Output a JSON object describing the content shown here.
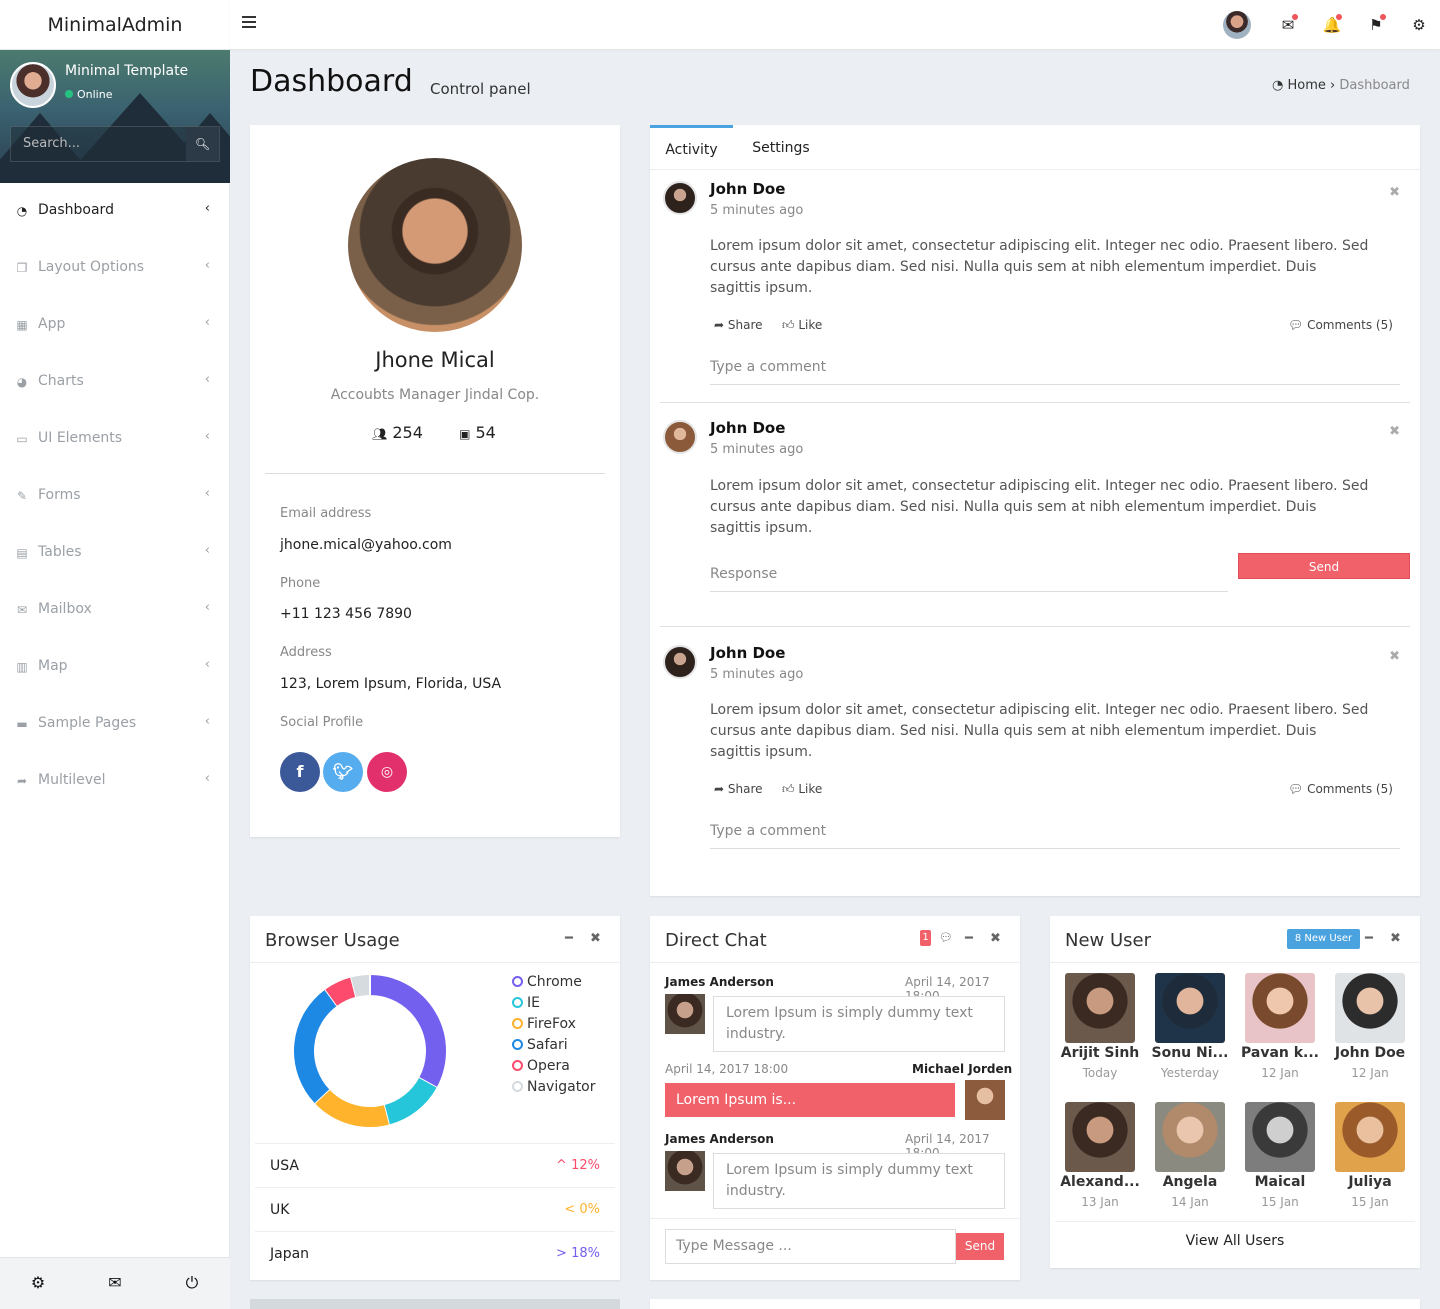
{
  "brand": "MinimalAdmin",
  "sidebar": {
    "user_name": "Minimal Template",
    "status": "Online",
    "search_placeholder": "Search...",
    "items": [
      {
        "label": "Dashboard",
        "icon": "dashboard-icon"
      },
      {
        "label": "Layout Options",
        "icon": "copy-icon"
      },
      {
        "label": "App",
        "icon": "grid-icon"
      },
      {
        "label": "Charts",
        "icon": "pie-chart-icon"
      },
      {
        "label": "UI Elements",
        "icon": "laptop-icon"
      },
      {
        "label": "Forms",
        "icon": "edit-icon"
      },
      {
        "label": "Tables",
        "icon": "table-icon"
      },
      {
        "label": "Mailbox",
        "icon": "envelope-icon"
      },
      {
        "label": "Map",
        "icon": "map-icon"
      },
      {
        "label": "Sample Pages",
        "icon": "folder-icon"
      },
      {
        "label": "Multilevel",
        "icon": "share-icon"
      }
    ],
    "footer_icons": [
      "gear-icon",
      "envelope-icon",
      "power-icon"
    ]
  },
  "page": {
    "title": "Dashboard",
    "subtitle": "Control panel",
    "breadcrumb_home": "Home",
    "breadcrumb_current": "Dashboard"
  },
  "profile": {
    "name": "Jhone Mical",
    "role": "Accoubts Manager Jindal Cop.",
    "followers": "254",
    "photos": "54",
    "email_label": "Email address",
    "email": "jhone.mical@yahoo.com",
    "phone_label": "Phone",
    "phone": "+11 123 456 7890",
    "address_label": "Address",
    "address": "123, Lorem Ipsum, Florida, USA",
    "social_label": "Social Profile"
  },
  "activity": {
    "tabs": [
      "Activity",
      "Settings"
    ],
    "posts": [
      {
        "name": "John Doe",
        "time": "5 minutes ago",
        "text": "Lorem ipsum dolor sit amet, consectetur adipiscing elit. Integer nec odio. Praesent libero. Sed cursus ante dapibus diam. Sed nisi. Nulla quis sem at nibh elementum imperdiet. Duis sagittis ipsum.",
        "share": "Share",
        "like": "Like",
        "comments": "Comments (5)",
        "placeholder": "Type a comment"
      },
      {
        "name": "John Doe",
        "time": "5 minutes ago",
        "text": "Lorem ipsum dolor sit amet, consectetur adipiscing elit. Integer nec odio. Praesent libero. Sed cursus ante dapibus diam. Sed nisi. Nulla quis sem at nibh elementum imperdiet. Duis sagittis ipsum.",
        "placeholder": "Response",
        "send": "Send"
      },
      {
        "name": "John Doe",
        "time": "5 minutes ago",
        "text": "Lorem ipsum dolor sit amet, consectetur adipiscing elit. Integer nec odio. Praesent libero. Sed cursus ante dapibus diam. Sed nisi. Nulla quis sem at nibh elementum imperdiet. Duis sagittis ipsum.",
        "share": "Share",
        "like": "Like",
        "comments": "Comments (5)",
        "placeholder": "Type a comment"
      }
    ]
  },
  "browser": {
    "title": "Browser Usage",
    "legend": [
      {
        "name": "Chrome",
        "color": "#7460ee",
        "value": 33
      },
      {
        "name": "IE",
        "color": "#26c6da",
        "value": 13
      },
      {
        "name": "FireFox",
        "color": "#ffb22b",
        "value": 17
      },
      {
        "name": "Safari",
        "color": "#1e88e5",
        "value": 27
      },
      {
        "name": "Opera",
        "color": "#fc4b6c",
        "value": 6
      },
      {
        "name": "Navigator",
        "color": "#d6dbe0",
        "value": 4
      }
    ],
    "rows": [
      {
        "country": "USA",
        "value": "12%",
        "arrow": "^",
        "color": "#fc4b6c"
      },
      {
        "country": "UK",
        "value": "0%",
        "arrow": "<",
        "color": "#ffb22b"
      },
      {
        "country": "Japan",
        "value": "18%",
        "arrow": ">",
        "color": "#7460ee"
      }
    ]
  },
  "chat": {
    "title": "Direct Chat",
    "badge": "1",
    "messages": [
      {
        "name": "James Anderson",
        "time": "April 14, 2017 18:00",
        "text": "Lorem Ipsum is simply dummy text industry."
      },
      {
        "name": "Michael Jorden",
        "time": "April 14, 2017 18:00",
        "text": "Lorem Ipsum is..."
      },
      {
        "name": "James Anderson",
        "time": "April 14, 2017 18:00",
        "text": "Lorem Ipsum is simply dummy text industry."
      }
    ],
    "placeholder": "Type Message ...",
    "send": "Send"
  },
  "users": {
    "title": "New User",
    "badge": "8 New User",
    "list": [
      {
        "name": "Arijit Sinh",
        "date": "Today"
      },
      {
        "name": "Sonu Ni...",
        "date": "Yesterday"
      },
      {
        "name": "Pavan k...",
        "date": "12 Jan"
      },
      {
        "name": "John Doe",
        "date": "12 Jan"
      },
      {
        "name": "Alexand...",
        "date": "13 Jan"
      },
      {
        "name": "Angela",
        "date": "14 Jan"
      },
      {
        "name": "Maical",
        "date": "15 Jan"
      },
      {
        "name": "Juliya",
        "date": "15 Jan"
      }
    ],
    "view_all": "View All Users"
  }
}
